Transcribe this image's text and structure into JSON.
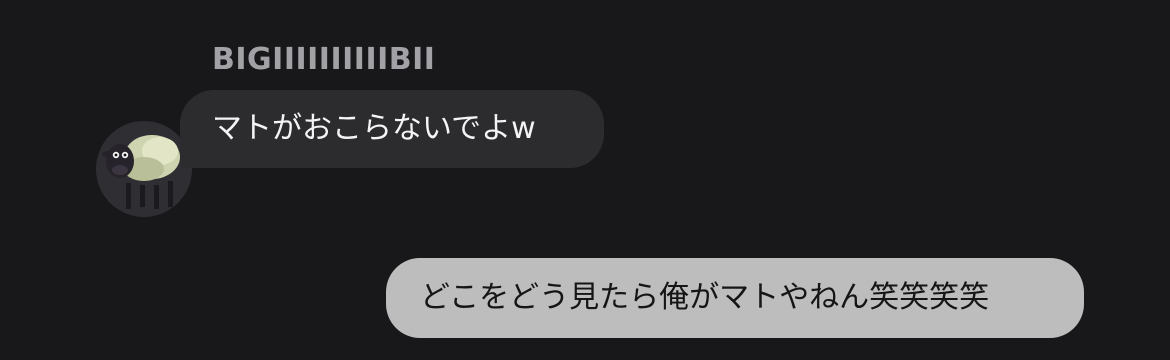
{
  "conversation": {
    "incoming": {
      "sender_name": "BIGIIIIIIIIIIBII",
      "text": "マトがおこらないでよw",
      "avatar_icon": "sheep-avatar-icon",
      "bubble_color": "#2c2c2f",
      "text_color": "#f4f4f6"
    },
    "outgoing": {
      "text": "どこをどう見たら俺がマトやねん笑笑笑笑",
      "bubble_color": "#bdbdbd",
      "text_color": "#151515"
    }
  },
  "colors": {
    "background": "#18181a",
    "sender_name": "#a2a2a6"
  }
}
